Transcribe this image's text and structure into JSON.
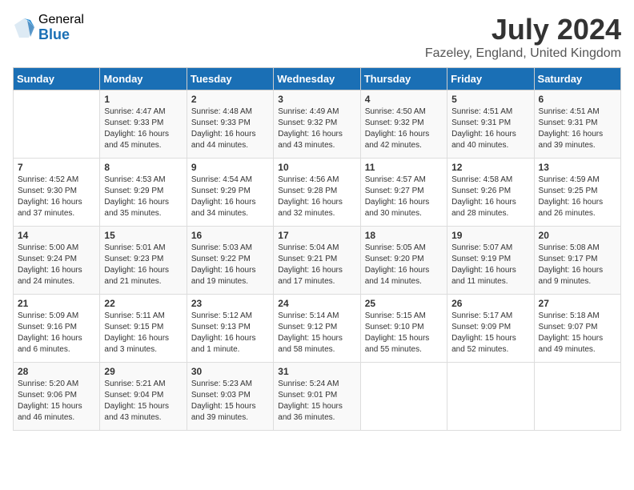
{
  "logo": {
    "general": "General",
    "blue": "Blue"
  },
  "title": {
    "month_year": "July 2024",
    "location": "Fazeley, England, United Kingdom"
  },
  "days_of_week": [
    "Sunday",
    "Monday",
    "Tuesday",
    "Wednesday",
    "Thursday",
    "Friday",
    "Saturday"
  ],
  "weeks": [
    [
      {
        "day": "",
        "info": ""
      },
      {
        "day": "1",
        "info": "Sunrise: 4:47 AM\nSunset: 9:33 PM\nDaylight: 16 hours\nand 45 minutes."
      },
      {
        "day": "2",
        "info": "Sunrise: 4:48 AM\nSunset: 9:33 PM\nDaylight: 16 hours\nand 44 minutes."
      },
      {
        "day": "3",
        "info": "Sunrise: 4:49 AM\nSunset: 9:32 PM\nDaylight: 16 hours\nand 43 minutes."
      },
      {
        "day": "4",
        "info": "Sunrise: 4:50 AM\nSunset: 9:32 PM\nDaylight: 16 hours\nand 42 minutes."
      },
      {
        "day": "5",
        "info": "Sunrise: 4:51 AM\nSunset: 9:31 PM\nDaylight: 16 hours\nand 40 minutes."
      },
      {
        "day": "6",
        "info": "Sunrise: 4:51 AM\nSunset: 9:31 PM\nDaylight: 16 hours\nand 39 minutes."
      }
    ],
    [
      {
        "day": "7",
        "info": "Sunrise: 4:52 AM\nSunset: 9:30 PM\nDaylight: 16 hours\nand 37 minutes."
      },
      {
        "day": "8",
        "info": "Sunrise: 4:53 AM\nSunset: 9:29 PM\nDaylight: 16 hours\nand 35 minutes."
      },
      {
        "day": "9",
        "info": "Sunrise: 4:54 AM\nSunset: 9:29 PM\nDaylight: 16 hours\nand 34 minutes."
      },
      {
        "day": "10",
        "info": "Sunrise: 4:56 AM\nSunset: 9:28 PM\nDaylight: 16 hours\nand 32 minutes."
      },
      {
        "day": "11",
        "info": "Sunrise: 4:57 AM\nSunset: 9:27 PM\nDaylight: 16 hours\nand 30 minutes."
      },
      {
        "day": "12",
        "info": "Sunrise: 4:58 AM\nSunset: 9:26 PM\nDaylight: 16 hours\nand 28 minutes."
      },
      {
        "day": "13",
        "info": "Sunrise: 4:59 AM\nSunset: 9:25 PM\nDaylight: 16 hours\nand 26 minutes."
      }
    ],
    [
      {
        "day": "14",
        "info": "Sunrise: 5:00 AM\nSunset: 9:24 PM\nDaylight: 16 hours\nand 24 minutes."
      },
      {
        "day": "15",
        "info": "Sunrise: 5:01 AM\nSunset: 9:23 PM\nDaylight: 16 hours\nand 21 minutes."
      },
      {
        "day": "16",
        "info": "Sunrise: 5:03 AM\nSunset: 9:22 PM\nDaylight: 16 hours\nand 19 minutes."
      },
      {
        "day": "17",
        "info": "Sunrise: 5:04 AM\nSunset: 9:21 PM\nDaylight: 16 hours\nand 17 minutes."
      },
      {
        "day": "18",
        "info": "Sunrise: 5:05 AM\nSunset: 9:20 PM\nDaylight: 16 hours\nand 14 minutes."
      },
      {
        "day": "19",
        "info": "Sunrise: 5:07 AM\nSunset: 9:19 PM\nDaylight: 16 hours\nand 11 minutes."
      },
      {
        "day": "20",
        "info": "Sunrise: 5:08 AM\nSunset: 9:17 PM\nDaylight: 16 hours\nand 9 minutes."
      }
    ],
    [
      {
        "day": "21",
        "info": "Sunrise: 5:09 AM\nSunset: 9:16 PM\nDaylight: 16 hours\nand 6 minutes."
      },
      {
        "day": "22",
        "info": "Sunrise: 5:11 AM\nSunset: 9:15 PM\nDaylight: 16 hours\nand 3 minutes."
      },
      {
        "day": "23",
        "info": "Sunrise: 5:12 AM\nSunset: 9:13 PM\nDaylight: 16 hours\nand 1 minute."
      },
      {
        "day": "24",
        "info": "Sunrise: 5:14 AM\nSunset: 9:12 PM\nDaylight: 15 hours\nand 58 minutes."
      },
      {
        "day": "25",
        "info": "Sunrise: 5:15 AM\nSunset: 9:10 PM\nDaylight: 15 hours\nand 55 minutes."
      },
      {
        "day": "26",
        "info": "Sunrise: 5:17 AM\nSunset: 9:09 PM\nDaylight: 15 hours\nand 52 minutes."
      },
      {
        "day": "27",
        "info": "Sunrise: 5:18 AM\nSunset: 9:07 PM\nDaylight: 15 hours\nand 49 minutes."
      }
    ],
    [
      {
        "day": "28",
        "info": "Sunrise: 5:20 AM\nSunset: 9:06 PM\nDaylight: 15 hours\nand 46 minutes."
      },
      {
        "day": "29",
        "info": "Sunrise: 5:21 AM\nSunset: 9:04 PM\nDaylight: 15 hours\nand 43 minutes."
      },
      {
        "day": "30",
        "info": "Sunrise: 5:23 AM\nSunset: 9:03 PM\nDaylight: 15 hours\nand 39 minutes."
      },
      {
        "day": "31",
        "info": "Sunrise: 5:24 AM\nSunset: 9:01 PM\nDaylight: 15 hours\nand 36 minutes."
      },
      {
        "day": "",
        "info": ""
      },
      {
        "day": "",
        "info": ""
      },
      {
        "day": "",
        "info": ""
      }
    ]
  ]
}
